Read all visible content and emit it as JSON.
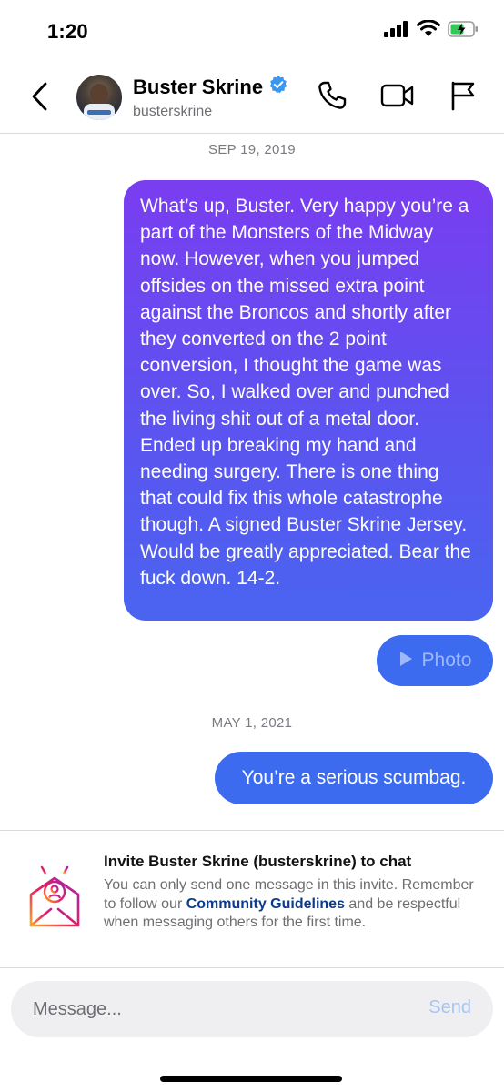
{
  "status_bar": {
    "time": "1:20"
  },
  "header": {
    "contact_name": "Buster Skrine",
    "contact_handle": "busterskrine",
    "verified": true
  },
  "conversation": {
    "date_1": "SEP 19, 2019",
    "message_1": "What’s up, Buster. Very happy you’re a part of the Monsters of the Midway now. However, when you jumped offsides on the missed extra point against the Broncos and shortly after they converted on the 2 point conversion, I thought the game was over. So, I walked over and punched the living shit out of a metal door. Ended up breaking my hand and needing surgery. There is one thing that could fix this whole catastrophe though. A signed Buster Skrine Jersey. Would be greatly appreciated. Bear the fuck down. 14-2.",
    "photo_label": "Photo",
    "date_2": "MAY 1, 2021",
    "message_2": "You’re a serious scumbag."
  },
  "invite": {
    "title": "Invite Buster Skrine (busterskrine) to chat",
    "body_before": "You can only send one message in this invite. Remember to follow our ",
    "link": "Community Guidelines",
    "body_after": " and be respectful when messaging others for the first time."
  },
  "composer": {
    "placeholder": "Message...",
    "send_label": "Send"
  },
  "colors": {
    "bubble_gradient_top": "#7a3df0",
    "bubble_gradient_bottom": "#4a64f0",
    "bubble_blue": "#3d6bf0",
    "link_blue": "#0b3c8c",
    "verified_blue": "#3897f0",
    "battery_green": "#34c759"
  },
  "icons": {
    "status": [
      "signal-bars-icon",
      "wifi-icon",
      "battery-charging-icon"
    ],
    "header": [
      "back-chevron-icon",
      "verified-badge-icon",
      "phone-icon",
      "video-camera-icon",
      "flag-icon"
    ],
    "photo": "play-icon",
    "invite": "invite-envelope-icon"
  }
}
